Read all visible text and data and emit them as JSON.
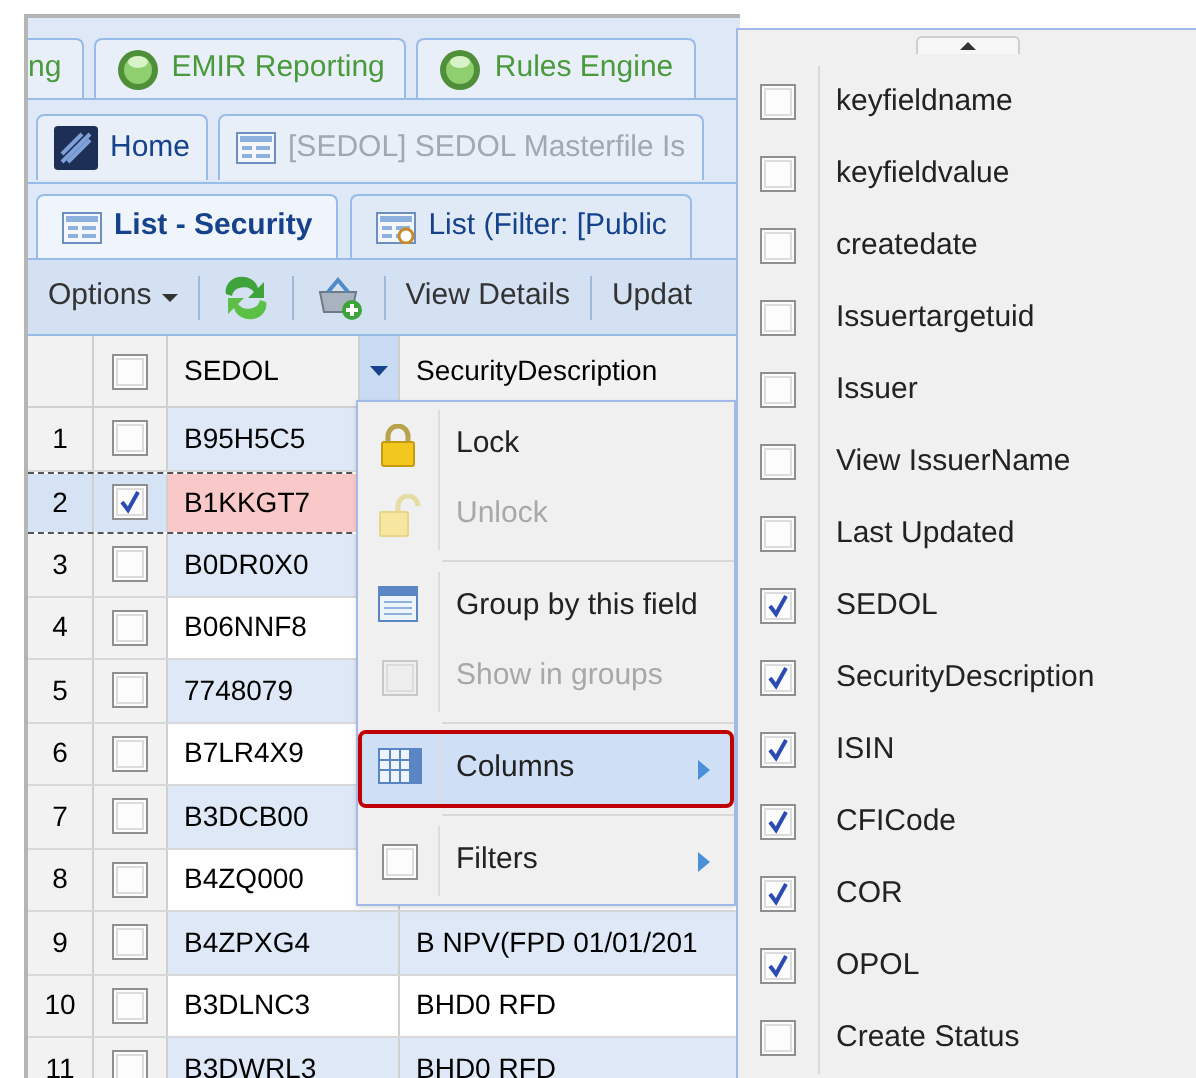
{
  "app_tabs": [
    {
      "label": "ng",
      "has_icon": false
    },
    {
      "label": "EMIR Reporting",
      "has_icon": true
    },
    {
      "label": "Rules Engine",
      "has_icon": true
    }
  ],
  "document_tabs": [
    {
      "label": "Home",
      "kind": "home",
      "disabled": false
    },
    {
      "label": "[SEDOL] SEDOL Masterfile Is",
      "kind": "list",
      "disabled": true
    }
  ],
  "view_tabs": [
    {
      "label": "List - Security",
      "kind": "list",
      "selected": true
    },
    {
      "label": "List (Filter: [Public",
      "kind": "filter",
      "selected": false
    }
  ],
  "toolbar": [
    {
      "kind": "menu",
      "label": "Options"
    },
    {
      "kind": "refresh"
    },
    {
      "kind": "add"
    },
    {
      "kind": "text",
      "label": "View Details"
    },
    {
      "kind": "text",
      "label": "Updat"
    }
  ],
  "grid": {
    "header_checked": false,
    "columns": [
      "SEDOL",
      "SecurityDescription"
    ],
    "rows": [
      {
        "number": "1",
        "checked": false,
        "selected": false,
        "flagged": false,
        "sedol": "B95H5C5"
      },
      {
        "number": "2",
        "checked": true,
        "selected": true,
        "flagged": true,
        "sedol": "B1KKGT7"
      },
      {
        "number": "3",
        "checked": false,
        "selected": false,
        "flagged": false,
        "sedol": "B0DR0X0"
      },
      {
        "number": "4",
        "checked": false,
        "selected": false,
        "flagged": false,
        "sedol": "B06NNF8"
      },
      {
        "number": "5",
        "checked": false,
        "selected": false,
        "flagged": false,
        "sedol": "7748079"
      },
      {
        "number": "6",
        "checked": false,
        "selected": false,
        "flagged": false,
        "sedol": "B7LR4X9"
      },
      {
        "number": "7",
        "checked": false,
        "selected": false,
        "flagged": false,
        "sedol": "B3DCB00"
      },
      {
        "number": "8",
        "checked": false,
        "selected": false,
        "flagged": false,
        "sedol": "B4ZQ000"
      },
      {
        "number": "9",
        "checked": false,
        "selected": false,
        "flagged": false,
        "sedol": "B4ZPXG4",
        "description": "B NPV(FPD 01/01/201"
      },
      {
        "number": "10",
        "checked": false,
        "selected": false,
        "flagged": false,
        "sedol": "B3DLNC3",
        "description": "BHD0 RFD"
      },
      {
        "number": "11",
        "checked": false,
        "selected": false,
        "flagged": false,
        "sedol": "B3DWRL3",
        "description": "BHD0 RFD"
      }
    ]
  },
  "column_menu": {
    "groups": [
      [
        {
          "label": "Lock",
          "kind": "lock",
          "disabled": false,
          "selected": false,
          "submenu": false
        },
        {
          "label": "Unlock",
          "kind": "unlock",
          "disabled": true,
          "selected": false,
          "submenu": false
        }
      ],
      [
        {
          "label": "Group by this field",
          "kind": "group",
          "disabled": false,
          "selected": false,
          "submenu": false
        },
        {
          "label": "Show in groups",
          "kind": "check",
          "checked": false,
          "disabled": true,
          "selected": false,
          "submenu": false
        }
      ],
      [
        {
          "label": "Columns",
          "kind": "columns",
          "disabled": false,
          "selected": true,
          "submenu": true
        }
      ],
      [
        {
          "label": "Filters",
          "kind": "check",
          "checked": false,
          "disabled": false,
          "selected": false,
          "submenu": true
        }
      ]
    ]
  },
  "columns_submenu": [
    {
      "label": "keyfieldname",
      "checked": false
    },
    {
      "label": "keyfieldvalue",
      "checked": false
    },
    {
      "label": "createdate",
      "checked": false
    },
    {
      "label": "Issuertargetuid",
      "checked": false
    },
    {
      "label": "Issuer",
      "checked": false
    },
    {
      "label": "View IssuerName",
      "checked": false
    },
    {
      "label": "Last Updated",
      "checked": false
    },
    {
      "label": "SEDOL",
      "checked": true
    },
    {
      "label": "SecurityDescription",
      "checked": true
    },
    {
      "label": "ISIN",
      "checked": true
    },
    {
      "label": "CFICode",
      "checked": true
    },
    {
      "label": "COR",
      "checked": true
    },
    {
      "label": "OPOL",
      "checked": true
    },
    {
      "label": "Create Status",
      "checked": false
    }
  ]
}
